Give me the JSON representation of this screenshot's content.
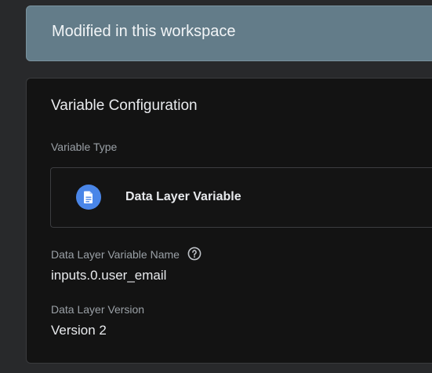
{
  "banner": {
    "text": "Modified in this workspace"
  },
  "config": {
    "title": "Variable Configuration",
    "type_label": "Variable Type",
    "type_name": "Data Layer Variable",
    "type_icon": "document-icon",
    "fields": [
      {
        "label": "Data Layer Variable Name",
        "value": "inputs.0.user_email",
        "help_icon": "help-circle-icon"
      },
      {
        "label": "Data Layer Version",
        "value": "Version 2"
      }
    ]
  },
  "colors": {
    "banner_bg": "#637c89",
    "card_bg": "#131313",
    "icon_accent": "#4a86e8"
  }
}
